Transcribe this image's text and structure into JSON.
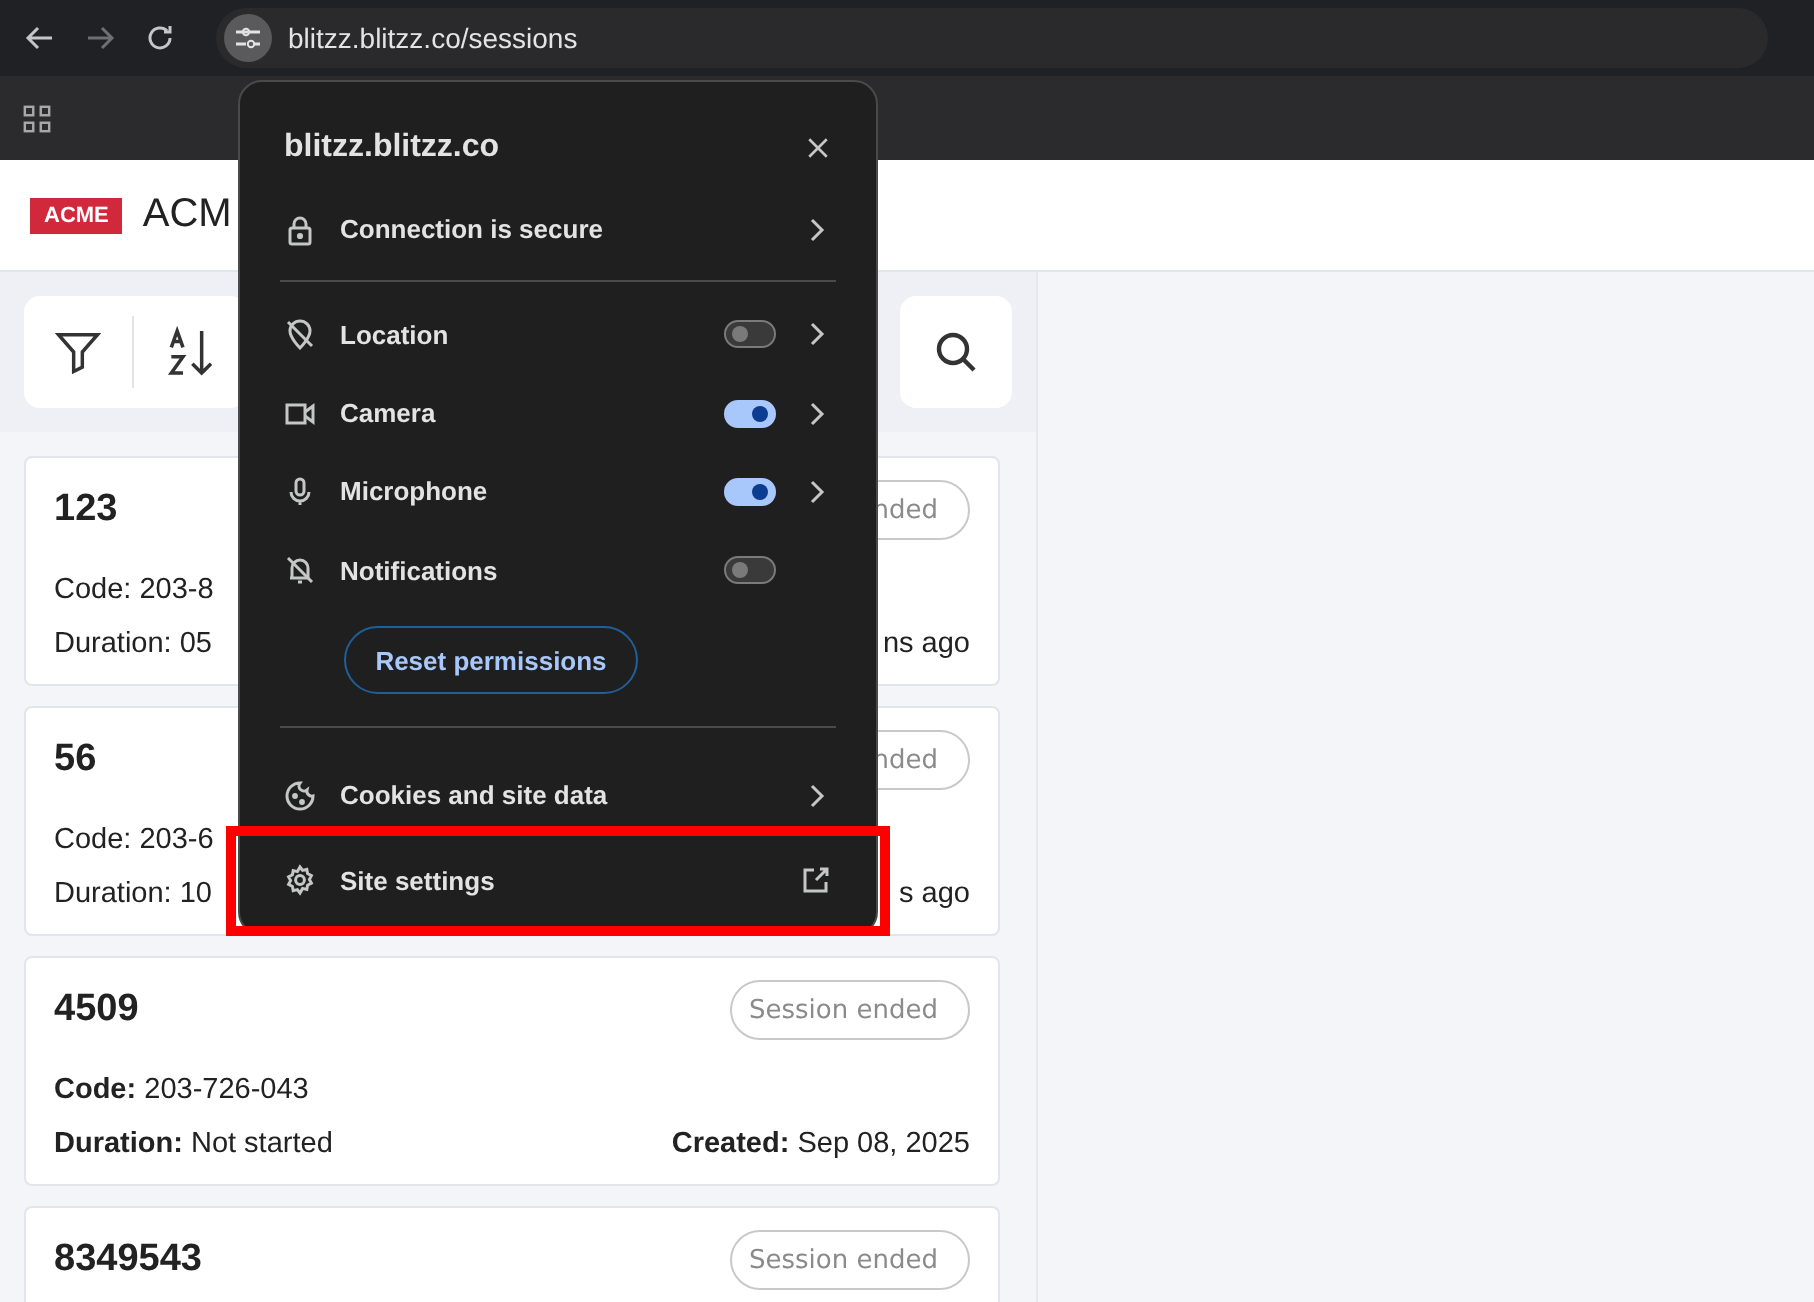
{
  "browser": {
    "url": "blitzz.blitzz.co/sessions"
  },
  "header": {
    "logo": "ACME",
    "title": "ACM"
  },
  "sessions": [
    {
      "title": "123",
      "status": "nded",
      "code": "Code: 203-8",
      "duration": "Duration: 05",
      "created": "ns ago"
    },
    {
      "title": "56",
      "status": "nded",
      "code": "Code: 203-6",
      "duration": "Duration: 10",
      "created": "s ago"
    },
    {
      "title": "4509",
      "status": "Session ended",
      "code_label": "Code:",
      "code": "203-726-043",
      "duration_label": "Duration:",
      "duration": "Not started",
      "created_label": "Created:",
      "created": "Sep 08, 2025"
    },
    {
      "title": "8349543",
      "status": "Session ended"
    }
  ],
  "popup": {
    "title": "blitzz.blitzz.co",
    "connection": "Connection is secure",
    "permissions": [
      {
        "kind": "location",
        "label": "Location",
        "on": false,
        "chevron": true
      },
      {
        "kind": "camera",
        "label": "Camera",
        "on": true,
        "chevron": true
      },
      {
        "kind": "microphone",
        "label": "Microphone",
        "on": true,
        "chevron": true
      },
      {
        "kind": "notifications",
        "label": "Notifications",
        "on": false,
        "chevron": false
      }
    ],
    "reset_button": "Reset permissions",
    "cookies": "Cookies and site data",
    "site_settings": "Site settings",
    "site_settings_highlighted": true
  }
}
